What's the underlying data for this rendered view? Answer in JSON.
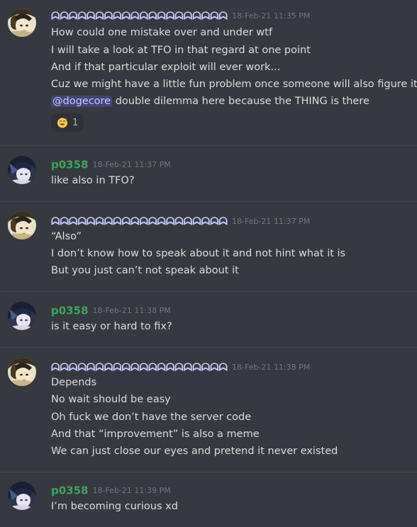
{
  "colors": {
    "background": "#36393f",
    "user_a": "#c4c9ff",
    "user_b": "#3ba55c",
    "timestamp": "#72767d",
    "text": "#dcddde",
    "mention_bg": "#5865f2"
  },
  "users": {
    "a": {
      "name": "ᗣᗣᗣᗣᗣᗣᗣᗣᗣᗣᗣᗣᗣᗣᗣᗣᗣᗣᗣᗣ"
    },
    "b": {
      "name": "p0358"
    }
  },
  "messages": [
    {
      "user": "a",
      "timestamp": "18-Feb-21 11:35 PM",
      "lines": [
        "How could one mistake over and under wtf",
        "I will take a look at TFO in that regard at one point",
        "And if that particular exploit will ever work...",
        "Cuz we might have a little fun problem once someone will also figure it out"
      ],
      "mention_line": {
        "mention": "@dogecore",
        "text": " double dilemma here because the THING is there"
      },
      "reaction": {
        "emoji_icon": "sweat-smile-icon",
        "count": "1"
      }
    },
    {
      "user": "b",
      "timestamp": "18-Feb-21 11:37 PM",
      "lines": [
        "like also in TFO?"
      ]
    },
    {
      "user": "a",
      "timestamp": "18-Feb-21 11:37 PM",
      "lines": [
        "“Also”",
        "I don’t know how to speak about it and not hint what it is",
        "But you just can’t not speak about it"
      ]
    },
    {
      "user": "b",
      "timestamp": "18-Feb-21 11:38 PM",
      "lines": [
        "is it easy or hard to fix?"
      ]
    },
    {
      "user": "a",
      "timestamp": "18-Feb-21 11:38 PM",
      "lines": [
        "Depends",
        "No wait should be easy",
        "Oh fuck we don’t have the server code",
        "And that “improvement” is also a meme",
        "We can just close our eyes and pretend it never existed"
      ]
    },
    {
      "user": "b",
      "timestamp": "18-Feb-21 11:39 PM",
      "lines": [
        "I’m becoming curious xd"
      ]
    }
  ]
}
